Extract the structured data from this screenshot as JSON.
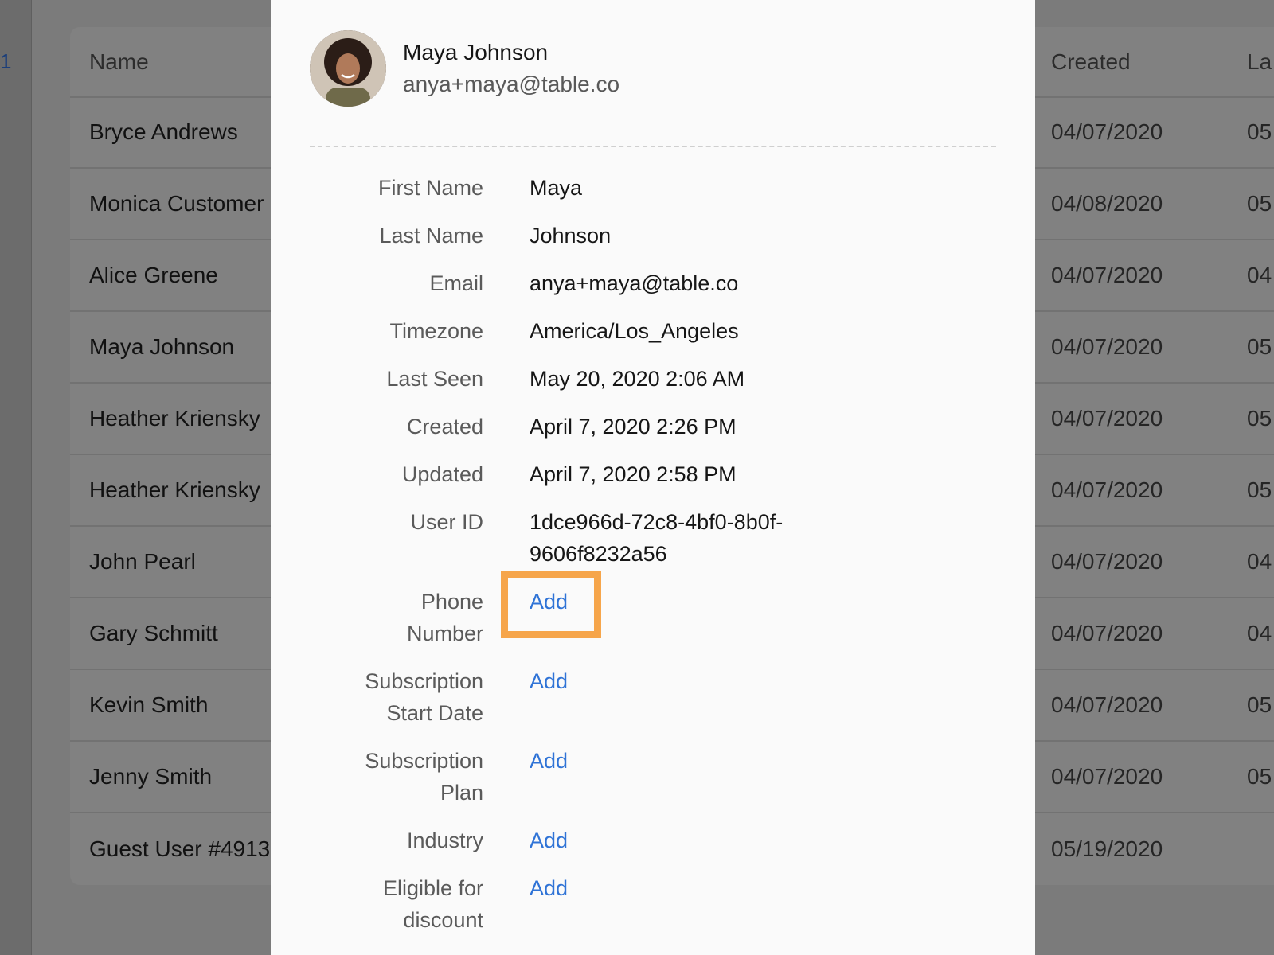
{
  "background": {
    "sidebar_partial_number": "1",
    "table": {
      "headers": {
        "name": "Name",
        "created": "Created",
        "last": "La"
      },
      "rows": [
        {
          "name": "Bryce Andrews",
          "created": "04/07/2020",
          "last": "05"
        },
        {
          "name": "Monica Customer",
          "created": "04/08/2020",
          "last": "05"
        },
        {
          "name": "Alice Greene",
          "created": "04/07/2020",
          "last": "04"
        },
        {
          "name": "Maya Johnson",
          "created": "04/07/2020",
          "last": "05"
        },
        {
          "name": "Heather Kriensky",
          "created": "04/07/2020",
          "last": "05"
        },
        {
          "name": "Heather Kriensky",
          "created": "04/07/2020",
          "last": "05"
        },
        {
          "name": "John Pearl",
          "created": "04/07/2020",
          "last": "04"
        },
        {
          "name": "Gary Schmitt",
          "created": "04/07/2020",
          "last": "04"
        },
        {
          "name": "Kevin Smith",
          "created": "04/07/2020",
          "last": "05"
        },
        {
          "name": "Jenny Smith",
          "created": "04/07/2020",
          "last": "05"
        },
        {
          "name": "Guest User #4913",
          "created": "05/19/2020",
          "last": ""
        }
      ]
    }
  },
  "profile": {
    "name": "Maya Johnson",
    "email": "anya+maya@table.co"
  },
  "fields": {
    "first_name": {
      "label": "First Name",
      "value": "Maya"
    },
    "last_name": {
      "label": "Last Name",
      "value": "Johnson"
    },
    "email": {
      "label": "Email",
      "value": "anya+maya@table.co"
    },
    "timezone": {
      "label": "Timezone",
      "value": "America/Los_Angeles"
    },
    "last_seen": {
      "label": "Last Seen",
      "value": "May 20, 2020 2:06 AM"
    },
    "created": {
      "label": "Created",
      "value": "April 7, 2020 2:26 PM"
    },
    "updated": {
      "label": "Updated",
      "value": "April 7, 2020 2:58 PM"
    },
    "user_id": {
      "label": "User ID",
      "value_line1": "1dce966d-72c8-4bf0-8b0f-",
      "value_line2": "9606f8232a56"
    },
    "phone_number": {
      "label_line1": "Phone",
      "label_line2": "Number",
      "action": "Add"
    },
    "subscription_start_date": {
      "label_line1": "Subscription",
      "label_line2": "Start Date",
      "action": "Add"
    },
    "subscription_plan": {
      "label_line1": "Subscription",
      "label_line2": "Plan",
      "action": "Add"
    },
    "industry": {
      "label": "Industry",
      "action": "Add"
    },
    "eligible_for_discount": {
      "label_line1": "Eligible for",
      "label_line2": "discount",
      "action": "Add"
    }
  },
  "colors": {
    "link": "#2f73d6",
    "highlight": "#f6a54a",
    "overlay": "#7b7b7b",
    "panel": "#fafafa"
  }
}
